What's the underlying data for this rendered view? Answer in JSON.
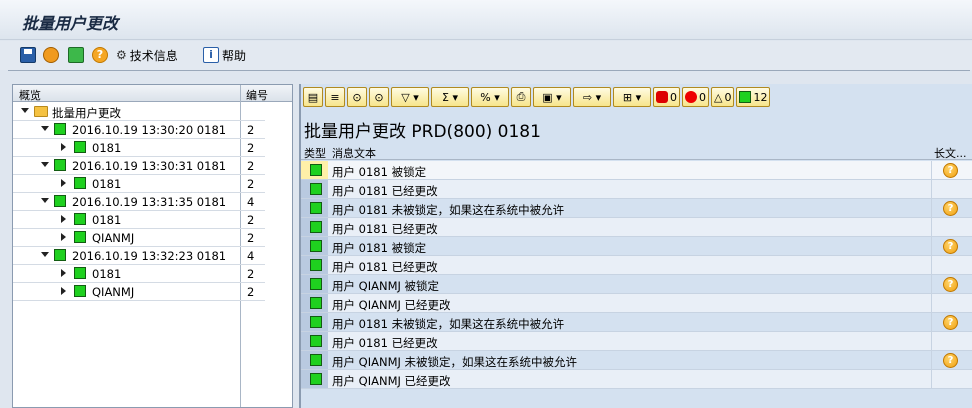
{
  "window": {
    "title": "批量用户更改"
  },
  "toolbar": {
    "tech_info": "技术信息",
    "help": "帮助"
  },
  "tree": {
    "col_overview": "概览",
    "col_number": "编号",
    "rows": [
      {
        "level": 0,
        "expand": "down",
        "text": "批量用户更改",
        "num": "",
        "icon": "folder-icon"
      },
      {
        "level": 1,
        "expand": "down",
        "text": "2016.10.19  13:30:20  0181",
        "num": "2",
        "icon": "status-green-icon"
      },
      {
        "level": 2,
        "expand": "right",
        "text": "0181",
        "num": "2",
        "icon": "status-green-icon"
      },
      {
        "level": 1,
        "expand": "down",
        "text": "2016.10.19  13:30:31  0181",
        "num": "2",
        "icon": "status-green-icon"
      },
      {
        "level": 2,
        "expand": "right",
        "text": "0181",
        "num": "2",
        "icon": "status-green-icon"
      },
      {
        "level": 1,
        "expand": "down",
        "text": "2016.10.19  13:31:35  0181",
        "num": "4",
        "icon": "status-green-icon"
      },
      {
        "level": 2,
        "expand": "right",
        "text": "0181",
        "num": "2",
        "icon": "status-green-icon"
      },
      {
        "level": 2,
        "expand": "right",
        "text": "QIANMJ",
        "num": "2",
        "icon": "status-green-icon"
      },
      {
        "level": 1,
        "expand": "down",
        "text": "2016.10.19  13:32:23  0181",
        "num": "4",
        "icon": "status-green-icon"
      },
      {
        "level": 2,
        "expand": "right",
        "text": "0181",
        "num": "2",
        "icon": "status-green-icon"
      },
      {
        "level": 2,
        "expand": "right",
        "text": "QIANMJ",
        "num": "2",
        "icon": "status-green-icon"
      }
    ]
  },
  "counters": {
    "stop": "0",
    "error": "0",
    "warning": "0",
    "success": "12"
  },
  "messages": {
    "title": "批量用户更改 PRD(800) 0181",
    "col_type": "类型",
    "col_text": "消息文本",
    "col_long": "长文...",
    "rows": [
      {
        "text": "用户 0181 被锁定",
        "long": true
      },
      {
        "text": "用户 0181 已经更改",
        "long": false
      },
      {
        "text": "用户 0181 未被锁定，如果这在系统中被允许",
        "long": true
      },
      {
        "text": "用户 0181 已经更改",
        "long": false
      },
      {
        "text": "用户 0181 被锁定",
        "long": true
      },
      {
        "text": "用户 0181 已经更改",
        "long": false
      },
      {
        "text": "用户 QIANMJ 被锁定",
        "long": true
      },
      {
        "text": "用户 QIANMJ 已经更改",
        "long": false
      },
      {
        "text": "用户 0181 未被锁定，如果这在系统中被允许",
        "long": true
      },
      {
        "text": "用户 0181 已经更改",
        "long": false
      },
      {
        "text": "用户 QIANMJ 未被锁定，如果这在系统中被允许",
        "long": true
      },
      {
        "text": "用户 QIANMJ 已经更改",
        "long": false
      }
    ]
  }
}
